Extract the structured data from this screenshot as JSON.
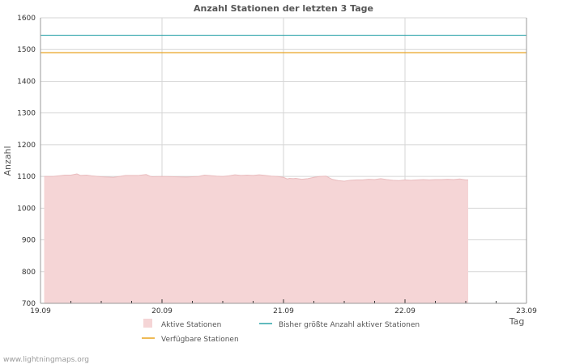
{
  "chart_data": {
    "type": "area",
    "title": "Anzahl Stationen der letzten 3 Tage",
    "xlabel": "Tag",
    "ylabel": "Anzahl",
    "ylim": [
      700,
      1600
    ],
    "xlim": [
      0,
      4
    ],
    "x_ticks": [
      "19.09",
      "20.09",
      "21.09",
      "22.09",
      "23.09"
    ],
    "y_ticks": [
      700,
      800,
      900,
      1000,
      1100,
      1200,
      1300,
      1400,
      1500,
      1600
    ],
    "grid": true,
    "legend_position": "bottom",
    "series": [
      {
        "name": "Aktive Stationen",
        "kind": "area",
        "color": "#f5d5d6",
        "edge_color": "#e9bcbe",
        "x": [
          0.03,
          0.1,
          0.15,
          0.2,
          0.25,
          0.3,
          0.33,
          0.38,
          0.42,
          0.5,
          0.55,
          0.6,
          0.65,
          0.7,
          0.75,
          0.8,
          0.87,
          0.9,
          0.92,
          1.0,
          1.1,
          1.2,
          1.3,
          1.35,
          1.45,
          1.5,
          1.55,
          1.6,
          1.65,
          1.7,
          1.75,
          1.8,
          1.85,
          1.9,
          1.95,
          2.0,
          2.03,
          2.05,
          2.08,
          2.1,
          2.15,
          2.2,
          2.25,
          2.3,
          2.35,
          2.4,
          2.45,
          2.5,
          2.55,
          2.6,
          2.65,
          2.7,
          2.75,
          2.8,
          2.85,
          2.9,
          2.95,
          3.0,
          3.05,
          3.1,
          3.15,
          3.2,
          3.25,
          3.3,
          3.35,
          3.4,
          3.45,
          3.5,
          3.52
        ],
        "values": [
          1100,
          1100,
          1102,
          1104,
          1104,
          1108,
          1103,
          1104,
          1102,
          1099,
          1098,
          1097,
          1100,
          1103,
          1103,
          1103,
          1106,
          1101,
          1099,
          1100,
          1099,
          1098,
          1100,
          1104,
          1101,
          1100,
          1102,
          1105,
          1103,
          1104,
          1103,
          1105,
          1103,
          1101,
          1100,
          1097,
          1092,
          1094,
          1093,
          1094,
          1091,
          1093,
          1097,
          1100,
          1101,
          1091,
          1087,
          1085,
          1088,
          1089,
          1089,
          1091,
          1090,
          1093,
          1090,
          1088,
          1087,
          1089,
          1088,
          1089,
          1090,
          1089,
          1090,
          1090,
          1091,
          1090,
          1092,
          1089,
          1089
        ]
      },
      {
        "name": "Bisher größte Anzahl aktiver Stationen",
        "kind": "line",
        "color": "#2aa2a8",
        "values": [
          1545
        ]
      },
      {
        "name": "Verfügbare Stationen",
        "kind": "line",
        "color": "#e8a21c",
        "values": [
          1490
        ]
      }
    ]
  },
  "footer": "www.lightningmaps.org"
}
